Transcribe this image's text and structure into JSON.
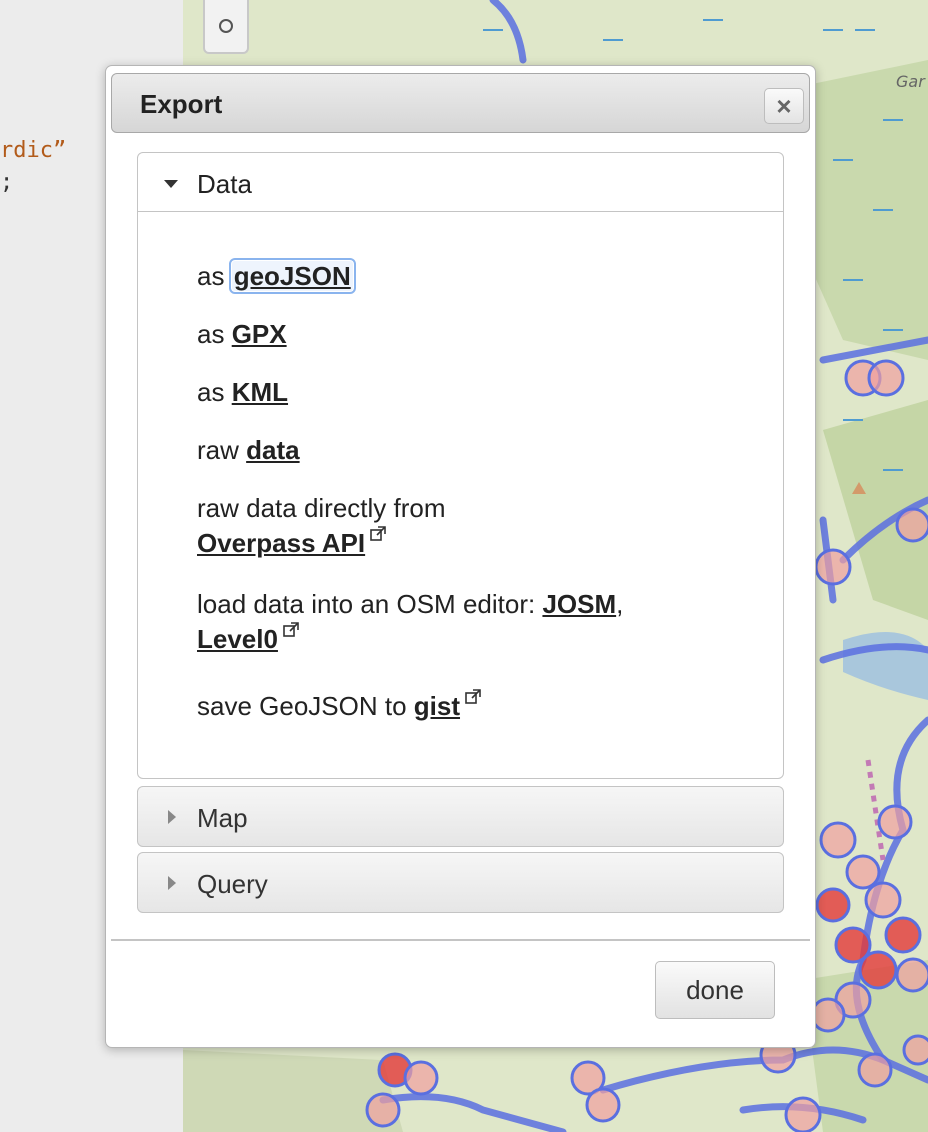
{
  "editor": {
    "line1": "rdic”",
    "line2": ";"
  },
  "map": {
    "label": "Gar"
  },
  "dialog": {
    "title": "Export",
    "close_icon": "×",
    "done_label": "done",
    "sections": {
      "data": {
        "label": "Data",
        "expanded": true,
        "rows": {
          "geojson": {
            "prefix": "as",
            "link": "geoJSON"
          },
          "gpx": {
            "prefix": "as",
            "link": "GPX"
          },
          "kml": {
            "prefix": "as",
            "link": "KML"
          },
          "raw": {
            "prefix": "raw",
            "link": "data"
          },
          "overpass": {
            "prefix": "raw data directly from",
            "link": "Overpass API"
          },
          "editor": {
            "prefix": "load data into an OSM editor:",
            "link1": "JOSM",
            "sep": ",",
            "link2": "Level0"
          },
          "gist": {
            "prefix": "save GeoJSON to",
            "link": "gist"
          }
        }
      },
      "map": {
        "label": "Map",
        "expanded": false
      },
      "query": {
        "label": "Query",
        "expanded": false
      }
    }
  },
  "colors": {
    "route": "#5a6fe0",
    "poi_fill": "#f0a0a0",
    "poi_stroke": "#5a6fe0",
    "poi_hot": "#e23a3a",
    "focus": "#8ab4ee"
  }
}
